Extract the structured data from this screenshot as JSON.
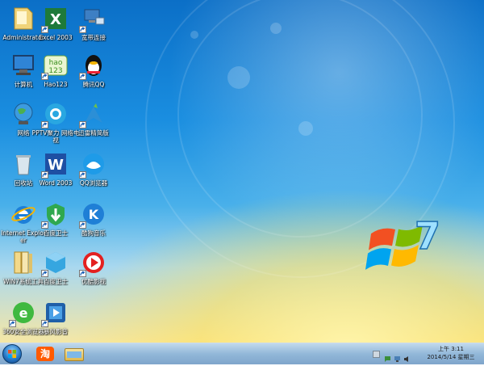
{
  "desktop": {
    "icons": [
      {
        "label": "Administrator",
        "icon": "folder-user-icon",
        "shortcut": false
      },
      {
        "label": "Excel 2003",
        "icon": "excel-icon",
        "shortcut": true
      },
      {
        "label": "宽带连接",
        "icon": "network-connection-icon",
        "shortcut": true
      },
      {
        "label": "计算机",
        "icon": "computer-icon",
        "shortcut": false
      },
      {
        "label": "Hao123",
        "icon": "hao123-icon",
        "shortcut": true
      },
      {
        "label": "腾讯QQ",
        "icon": "qq-penguin-icon",
        "shortcut": true
      },
      {
        "label": "网络",
        "icon": "network-globe-icon",
        "shortcut": false
      },
      {
        "label": "PPTV聚力 网络电视",
        "icon": "pptv-icon",
        "shortcut": true
      },
      {
        "label": "迅雷精简版",
        "icon": "xunlei-icon",
        "shortcut": true
      },
      {
        "label": "回收站",
        "icon": "recycle-bin-icon",
        "shortcut": false
      },
      {
        "label": "Word 2003",
        "icon": "word-icon",
        "shortcut": true
      },
      {
        "label": "QQ浏览器",
        "icon": "qq-browser-icon",
        "shortcut": true
      },
      {
        "label": "Internet Explorer",
        "icon": "internet-explorer-icon",
        "shortcut": false
      },
      {
        "label": "百度卫士",
        "icon": "baidu-guard-icon",
        "shortcut": true
      },
      {
        "label": "酷狗音乐",
        "icon": "kugou-icon",
        "shortcut": true
      },
      {
        "label": "WIN7系统工具",
        "icon": "toolbox-folder-icon",
        "shortcut": false
      },
      {
        "label": "百度卫士",
        "icon": "baidu-box-icon",
        "shortcut": true
      },
      {
        "label": "优酷影视",
        "icon": "youku-icon",
        "shortcut": true
      },
      {
        "label": "360安全浏览器",
        "icon": "360-browser-icon",
        "shortcut": true
      },
      {
        "label": "暴风影音",
        "icon": "baofeng-icon",
        "shortcut": true
      }
    ]
  },
  "taskbar": {
    "start_icon": "windows-start-orb-icon",
    "pinned": [
      {
        "icon": "taobao-icon",
        "label": "淘"
      },
      {
        "icon": "file-explorer-icon",
        "label": ""
      }
    ],
    "tray_icons": [
      "show-hidden-icons-icon",
      "action-center-icon",
      "network-status-icon",
      "volume-icon"
    ],
    "time": "上午 3:11",
    "date": "2014/5/14 星期三"
  },
  "colors": {
    "sky_blue": "#1a8ee0",
    "warm_yellow": "#f5e7a5",
    "taskbar": "#8cb4d7"
  }
}
